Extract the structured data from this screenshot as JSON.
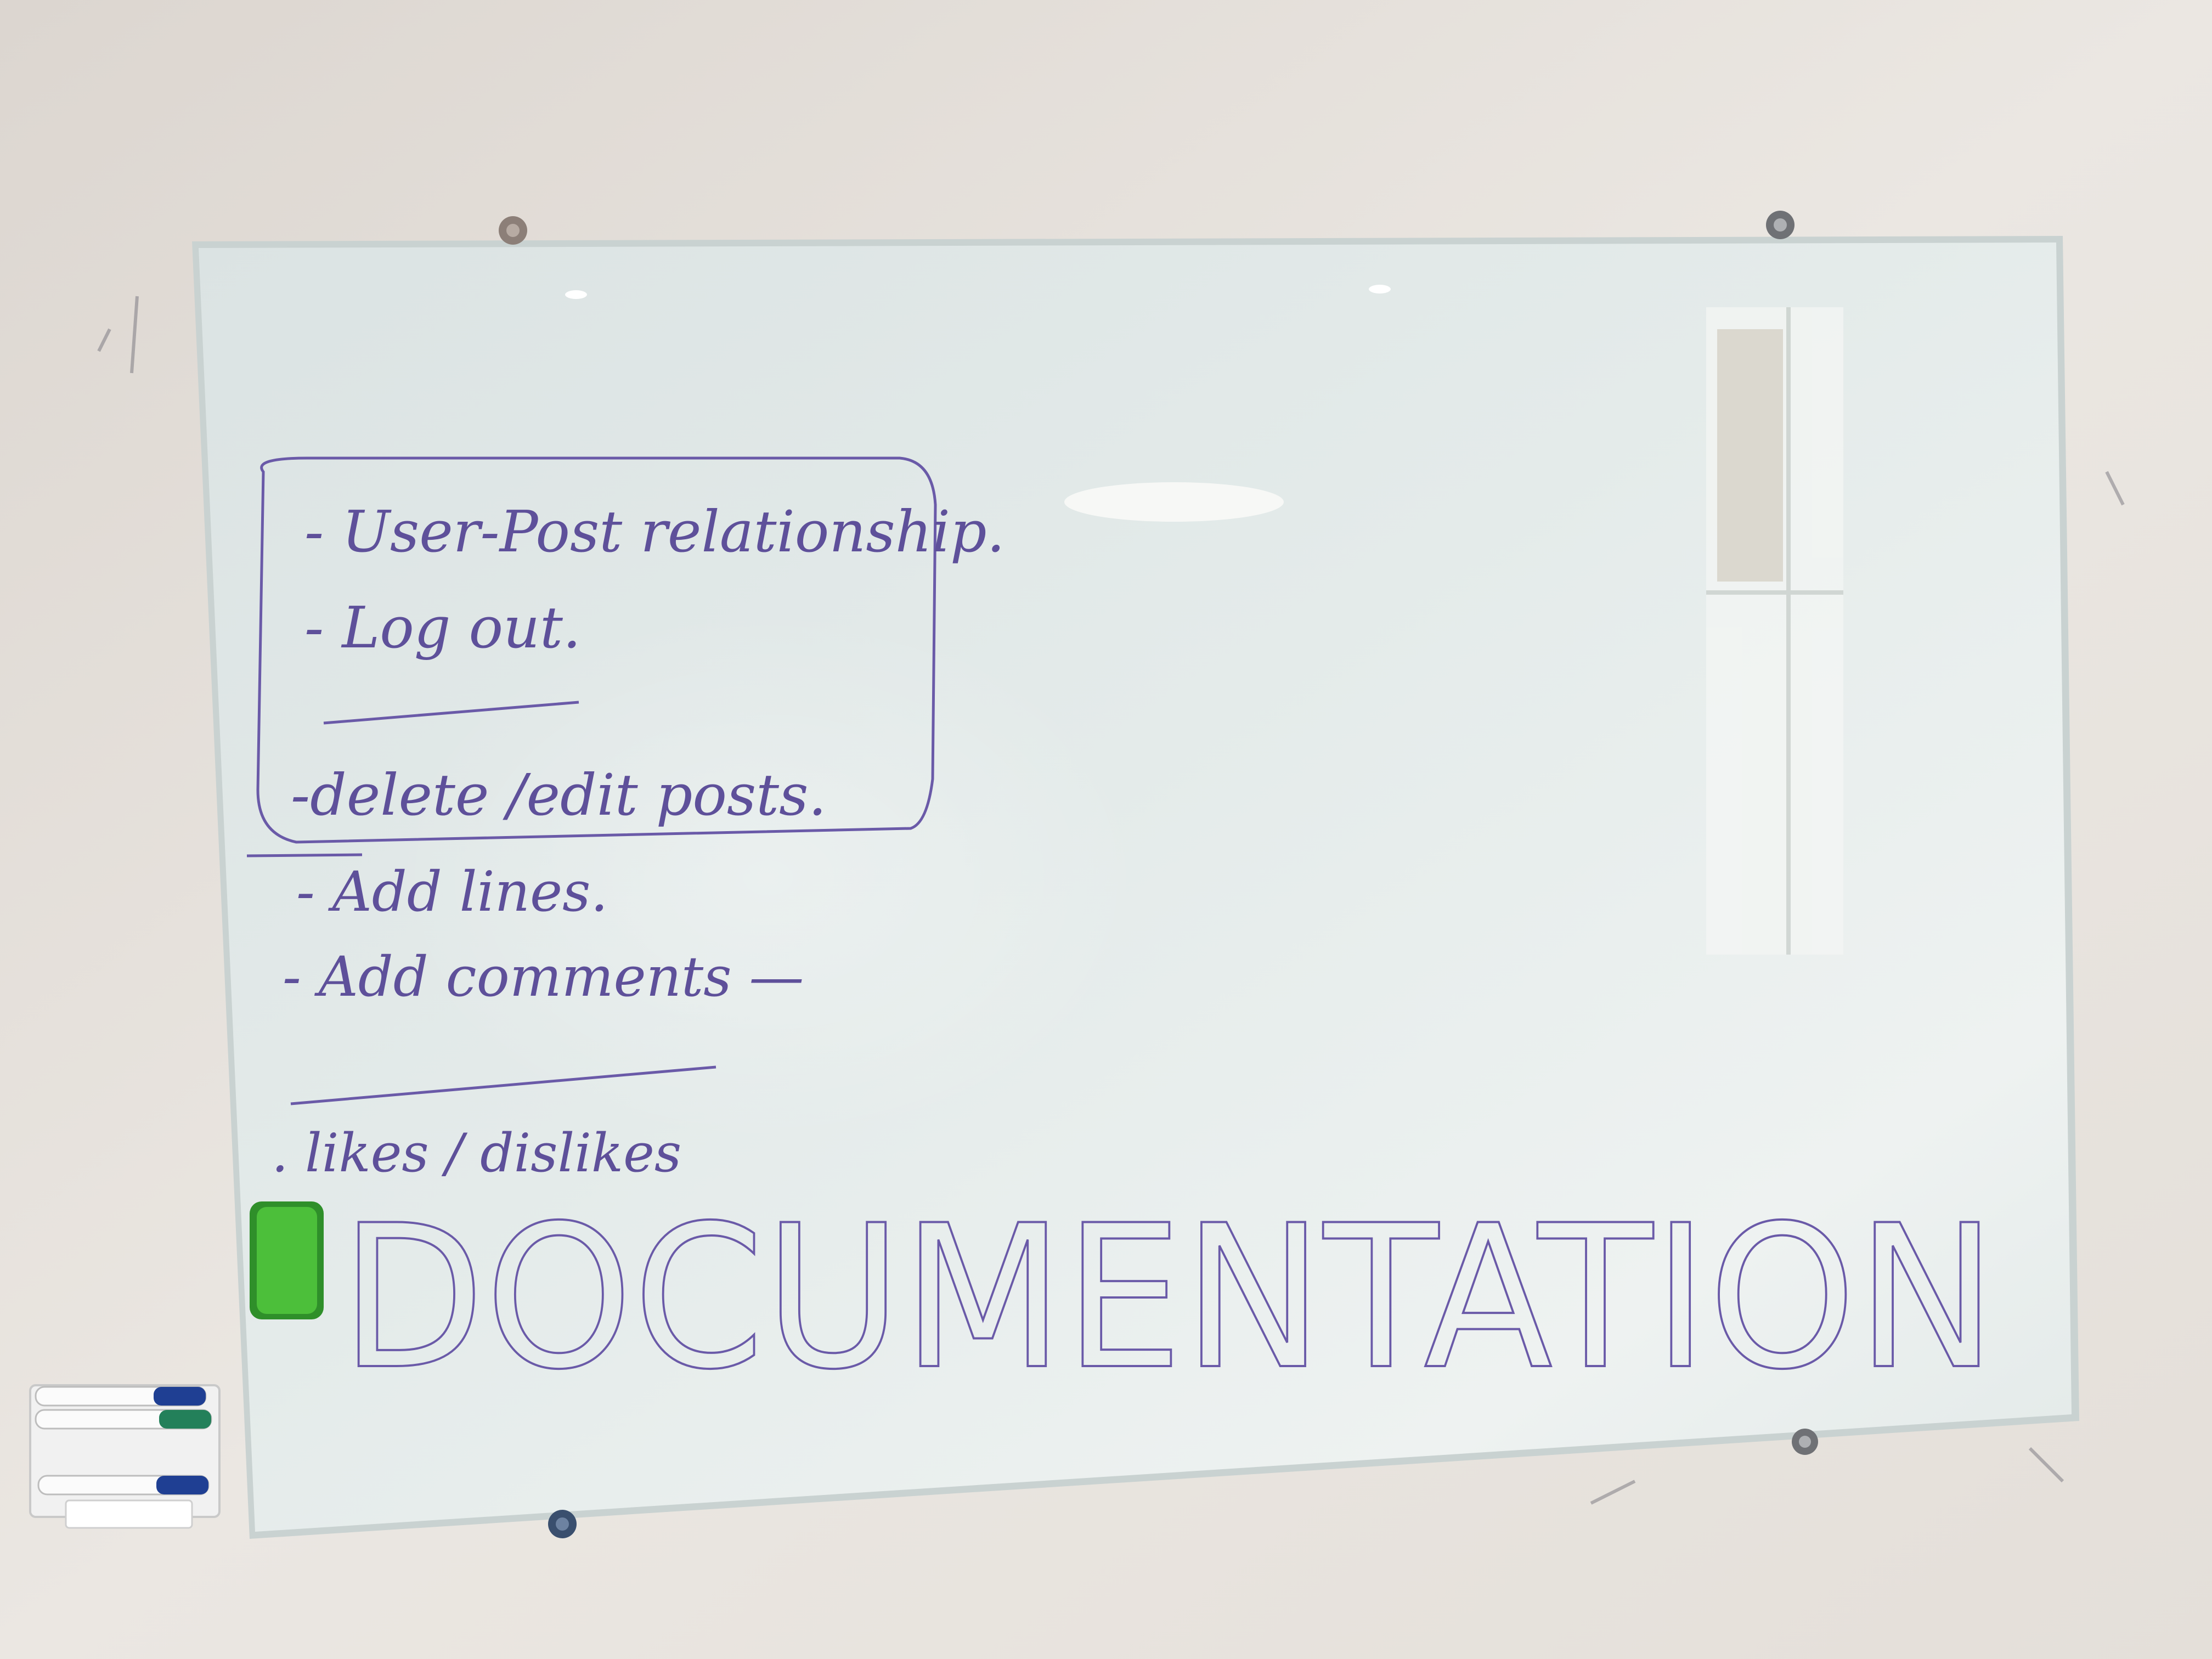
{
  "whiteboard": {
    "todo_items": [
      "- User-Post relationship.",
      "- Log out.",
      "-delete /edit posts."
    ],
    "more_items": [
      "- Add lines.",
      "- Add comments —",
      ". likes / dislikes"
    ],
    "headline": "DOCUMENTATION"
  },
  "colors": {
    "wall": "#e6e1db",
    "glass": "#dde6e6",
    "ink": "#5e509a",
    "eraser": "#4cbf3a"
  },
  "icons": [
    "eraser",
    "marker-blue",
    "marker-green",
    "marker-holder",
    "glass-standoff"
  ]
}
